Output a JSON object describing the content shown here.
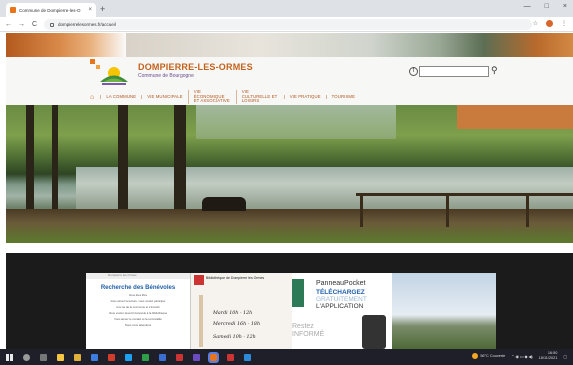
{
  "browser": {
    "tab_title": "Commune de Dompierre-les-O",
    "tab_close": "×",
    "new_tab": "+",
    "url": "dompierrelesormes.fr/accueil",
    "window_controls": [
      "—",
      "□",
      "×"
    ]
  },
  "site": {
    "title": "DOMPIERRE-LES-ORMES",
    "subtitle": "Commune de Bourgogne",
    "search_placeholder": "",
    "menu": [
      "LA COMMUNE",
      "VIE MUNICIPALE",
      "VIE ÉCONOMIQUE ET ASSOCIATIVE",
      "VIE CULTURELLE ET LOISIRS",
      "VIE PRATIQUE",
      "TOURISME"
    ]
  },
  "cards": {
    "benevoles": {
      "top": "Dompierre les Ormes",
      "heading": "Recherche des Bénévoles",
      "lines": [
        "Vous êtes libre",
        "Vous aimez la lecture, vous voulez participer",
        "à la vie de la commune et s'investir",
        "Vous voulez devenir bénévole à la bibliothèque",
        "Vous aimez le contact et la convivialité",
        "Nous vous attendons"
      ]
    },
    "bibliotheque": {
      "label": "Bibliothèque de Dompierre les Ormes",
      "hours": [
        "Mardi 10h - 12h",
        "Mercredi 16h - 18h",
        "Samedi 10h - 12h"
      ]
    },
    "panneaupocket": {
      "t1": "PanneauPocket",
      "t2": "TÉLÉCHARGEZ",
      "t3": "GRATUITEMENT",
      "t4": "L'APPLICATION",
      "t5": "Restez\nINFORMÉ"
    }
  },
  "taskbar": {
    "weather": "56°C  Couverte",
    "clock_time": "16:50",
    "clock_date": "18/11/2021"
  }
}
